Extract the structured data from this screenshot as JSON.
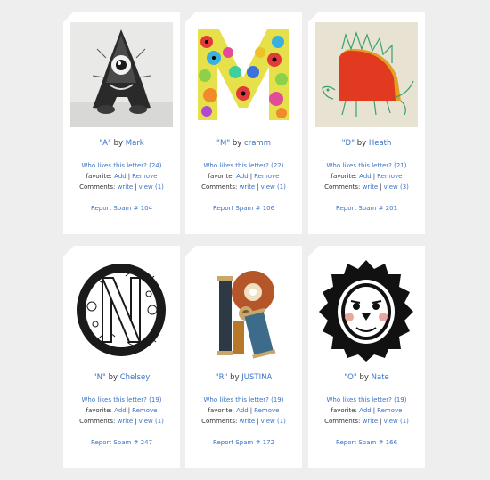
{
  "cards": [
    {
      "letter": "A",
      "by": "by",
      "author": "Mark",
      "likes_label": "Who likes this letter?",
      "likes_count": "(24)",
      "favorite_label": "favorite:",
      "add_label": "Add",
      "remove_label": "Remove",
      "comments_label": "Comments:",
      "write_label": "write",
      "view_label": "view",
      "view_count": "(1)",
      "spam_label": "Report Spam",
      "spam_number": "# 104"
    },
    {
      "letter": "M",
      "by": "by",
      "author": "cramm",
      "likes_label": "Who likes this letter?",
      "likes_count": "(22)",
      "favorite_label": "favorite:",
      "add_label": "Add",
      "remove_label": "Remove",
      "comments_label": "Comments:",
      "write_label": "write",
      "view_label": "view",
      "view_count": "(1)",
      "spam_label": "Report Spam",
      "spam_number": "# 106"
    },
    {
      "letter": "D",
      "by": "by",
      "author": "Heath",
      "likes_label": "Who likes this letter?",
      "likes_count": "(21)",
      "favorite_label": "favorite:",
      "add_label": "Add",
      "remove_label": "Remove",
      "comments_label": "Comments:",
      "write_label": "write",
      "view_label": "view",
      "view_count": "(3)",
      "spam_label": "Report Spam",
      "spam_number": "# 201"
    },
    {
      "letter": "N",
      "by": "by",
      "author": "Chelsey",
      "likes_label": "Who likes this letter?",
      "likes_count": "(19)",
      "favorite_label": "favorite:",
      "add_label": "Add",
      "remove_label": "Remove",
      "comments_label": "Comments:",
      "write_label": "write",
      "view_label": "view",
      "view_count": "(1)",
      "spam_label": "Report Spam",
      "spam_number": "# 247"
    },
    {
      "letter": "R",
      "by": "by",
      "author": "JUSTINA",
      "likes_label": "Who likes this letter?",
      "likes_count": "(19)",
      "favorite_label": "favorite:",
      "add_label": "Add",
      "remove_label": "Remove",
      "comments_label": "Comments:",
      "write_label": "write",
      "view_label": "view",
      "view_count": "(1)",
      "spam_label": "Report Spam",
      "spam_number": "# 172"
    },
    {
      "letter": "O",
      "by": "by",
      "author": "Nate",
      "likes_label": "Who likes this letter?",
      "likes_count": "(19)",
      "favorite_label": "favorite:",
      "add_label": "Add",
      "remove_label": "Remove",
      "comments_label": "Comments:",
      "write_label": "write",
      "view_label": "view",
      "view_count": "(1)",
      "spam_label": "Report Spam",
      "spam_number": "# 166"
    }
  ],
  "colors": {
    "link": "#3b73c6",
    "text": "#333333",
    "page_bg": "#eeeeee",
    "card_bg": "#ffffff"
  }
}
